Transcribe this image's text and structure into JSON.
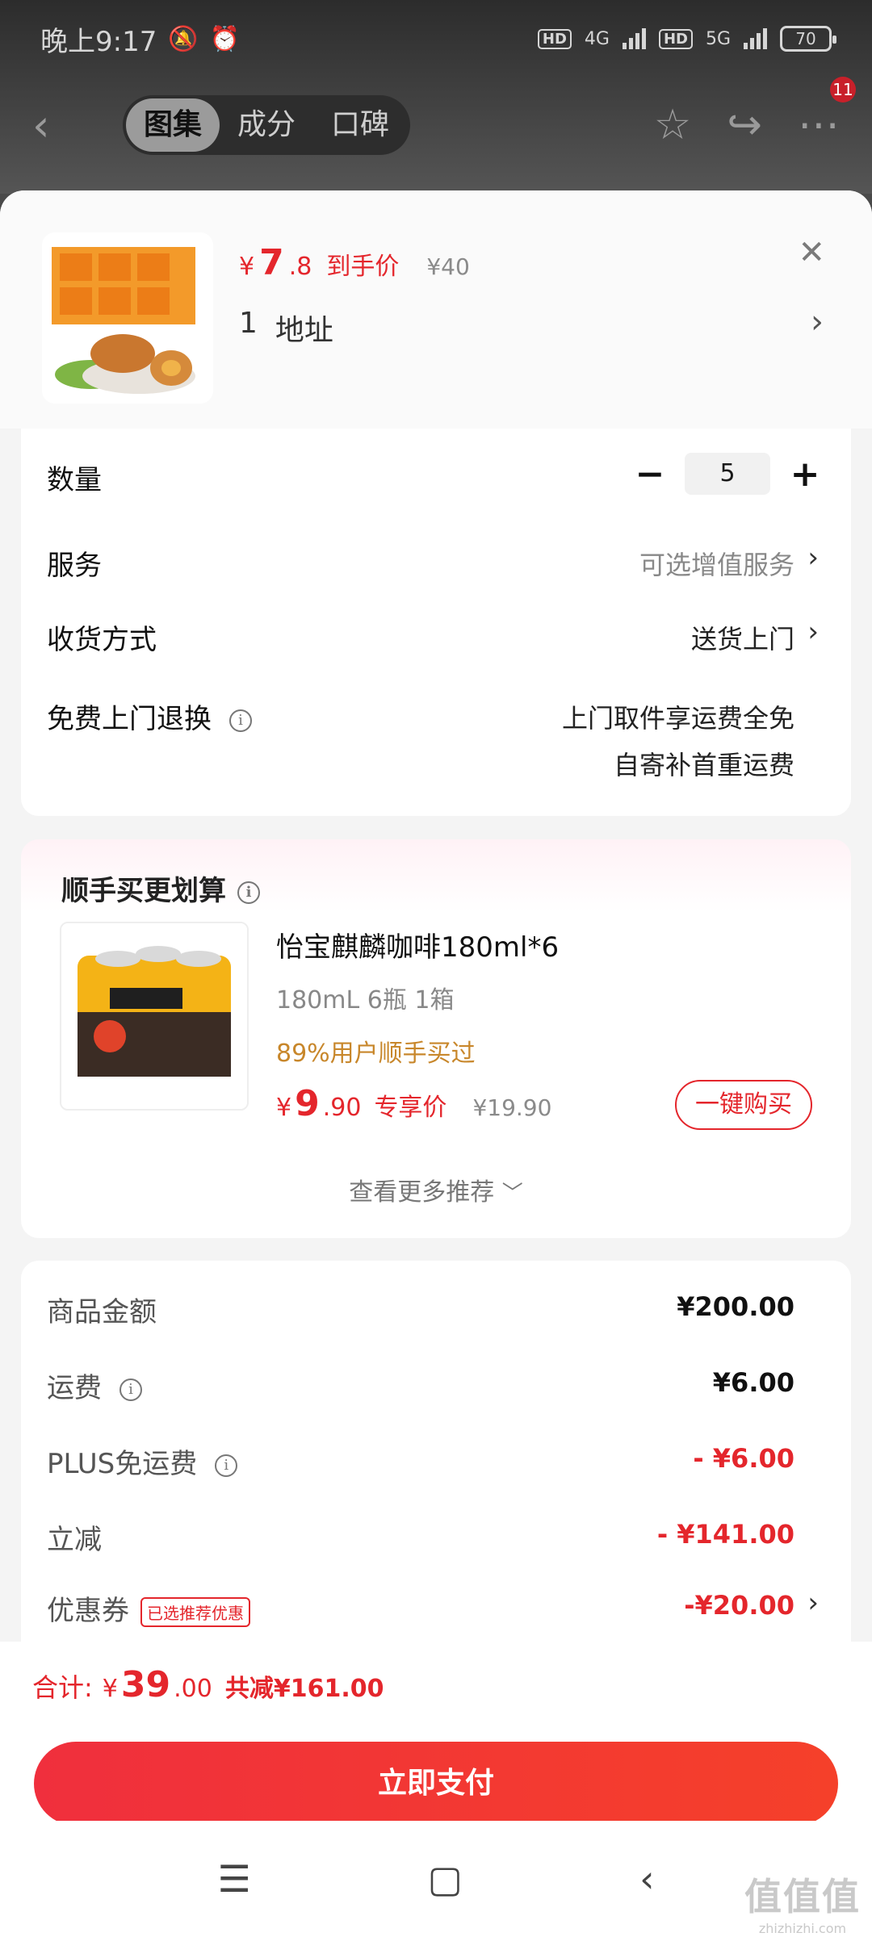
{
  "status_bar": {
    "time": "晚上9:17",
    "sig1": "4G",
    "sig2": "5G",
    "hd": "HD",
    "battery": "70"
  },
  "nav": {
    "tabs": [
      "图集",
      "成分",
      "口碑"
    ],
    "badge_count": "11"
  },
  "product": {
    "currency": "¥",
    "price_int": "7",
    "price_dec": ".8",
    "price_tag": "到手价",
    "original_price": "¥40",
    "address_num": "1",
    "address_label": "地址"
  },
  "options": {
    "quantity_label": "数量",
    "quantity_value": "5",
    "service_label": "服务",
    "service_value": "可选增值服务",
    "delivery_label": "收货方式",
    "delivery_value": "送货上门",
    "return_label": "免费上门退换",
    "return_line1": "上门取件享运费全免",
    "return_line2": "自寄补首重运费"
  },
  "recommendation": {
    "title": "顺手买更划算",
    "name": "怡宝麒麟咖啡180ml*6",
    "spec": "180mL 6瓶 1箱",
    "stat": "89%用户顺手买过",
    "currency": "¥",
    "price_int": "9",
    "price_dec": ".90",
    "price_tag": "专享价",
    "original_price": "¥19.90",
    "buy_label": "一键购买",
    "more_label": "查看更多推荐"
  },
  "summary": {
    "goods_label": "商品金额",
    "goods_value": "¥200.00",
    "shipping_label": "运费",
    "shipping_value": "¥6.00",
    "plus_label": "PLUS免运费",
    "plus_value": "- ¥6.00",
    "discount_label": "立减",
    "discount_value": "- ¥141.00",
    "coupon_label": "优惠券",
    "coupon_tag": "已选推荐优惠",
    "coupon_value": "-¥20.00"
  },
  "footer": {
    "total_label": "合计:",
    "currency": "¥",
    "total_int": "39",
    "total_dec": ".00",
    "saved": "共减¥161.00",
    "pay_label": "立即支付"
  },
  "watermark": {
    "main": "值值值",
    "sub": "zhizhizhi.com"
  },
  "colors": {
    "accent_red": "#e4262c",
    "gold": "#c8872b"
  }
}
